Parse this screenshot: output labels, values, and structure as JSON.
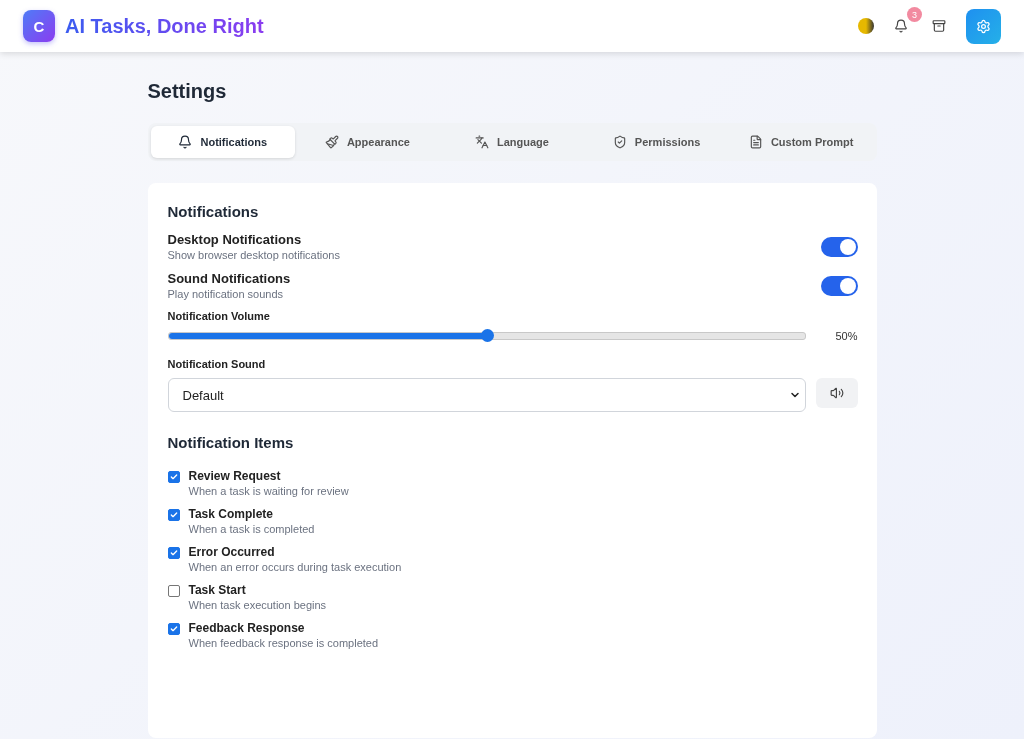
{
  "header": {
    "logo": "C",
    "title": "AI Tasks, Done Right",
    "notification_count": "3",
    "settings_active": true
  },
  "page_title": "Settings",
  "tabs": [
    {
      "label": "Notifications",
      "selected": true
    },
    {
      "label": "Appearance",
      "selected": false
    },
    {
      "label": "Language",
      "selected": false
    },
    {
      "label": "Permissions",
      "selected": false
    },
    {
      "label": "Custom Prompt",
      "selected": false
    }
  ],
  "section_title": "Notifications",
  "toggles": [
    {
      "label": "Desktop Notifications",
      "description": "Show browser desktop notifications",
      "on": true
    },
    {
      "label": "Sound Notifications",
      "description": "Play notification sounds",
      "on": true
    }
  ],
  "volume": {
    "label": "Notification Volume",
    "level": 0.5,
    "reading": "50%"
  },
  "sound": {
    "label": "Notification Sound",
    "value": "Default"
  },
  "items_title": "Notification Items",
  "items": [
    {
      "label": "Review Request",
      "description": "When a task is waiting for review",
      "checked": true
    },
    {
      "label": "Task Complete",
      "description": "When a task is completed",
      "checked": true
    },
    {
      "label": "Error Occurred",
      "description": "When an error occurs during task execution",
      "checked": true
    },
    {
      "label": "Task Start",
      "description": "When task execution begins",
      "checked": false
    },
    {
      "label": "Feedback Response",
      "description": "When feedback response is completed",
      "checked": true
    }
  ]
}
